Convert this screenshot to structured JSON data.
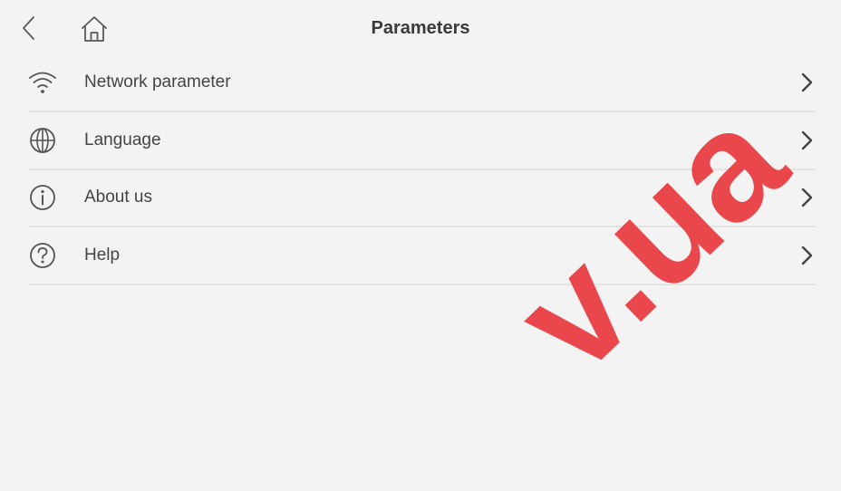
{
  "header": {
    "title": "Parameters",
    "back_icon": "chevron-left-icon",
    "home_icon": "home-icon"
  },
  "menu": {
    "items": [
      {
        "label": "Network parameter",
        "icon": "wifi-icon"
      },
      {
        "label": "Language",
        "icon": "globe-icon"
      },
      {
        "label": "About us",
        "icon": "info-circle-icon"
      },
      {
        "label": "Help",
        "icon": "help-circle-icon"
      }
    ],
    "chevron_icon": "chevron-right-icon"
  },
  "watermark": {
    "text": "v.ua",
    "color": "#e8343a"
  },
  "colors": {
    "background": "#f3f3f3",
    "text": "#444444",
    "title": "#3a3a3a",
    "divider": "#e3e3e3",
    "icon": "#555555"
  }
}
